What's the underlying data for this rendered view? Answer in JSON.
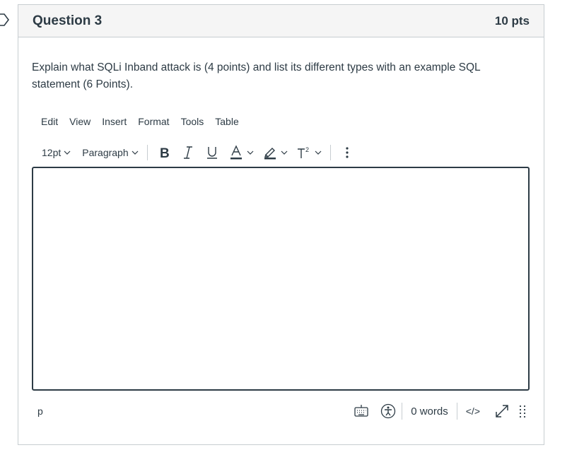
{
  "question": {
    "title": "Question 3",
    "points": "10 pts",
    "text": "Explain what SQLi Inband attack is (4 points) and list its different types with an example SQL statement (6 Points)."
  },
  "editor": {
    "menu": [
      "Edit",
      "View",
      "Insert",
      "Format",
      "Tools",
      "Table"
    ],
    "toolbar": {
      "font_size": "12pt",
      "block_format": "Paragraph"
    },
    "content": "",
    "status": {
      "path": "p",
      "word_count": "0 words",
      "html_toggle": "</>"
    }
  },
  "colors": {
    "text": "#2d3b45",
    "border": "#c7cdd1",
    "header_bg": "#f5f5f5"
  }
}
